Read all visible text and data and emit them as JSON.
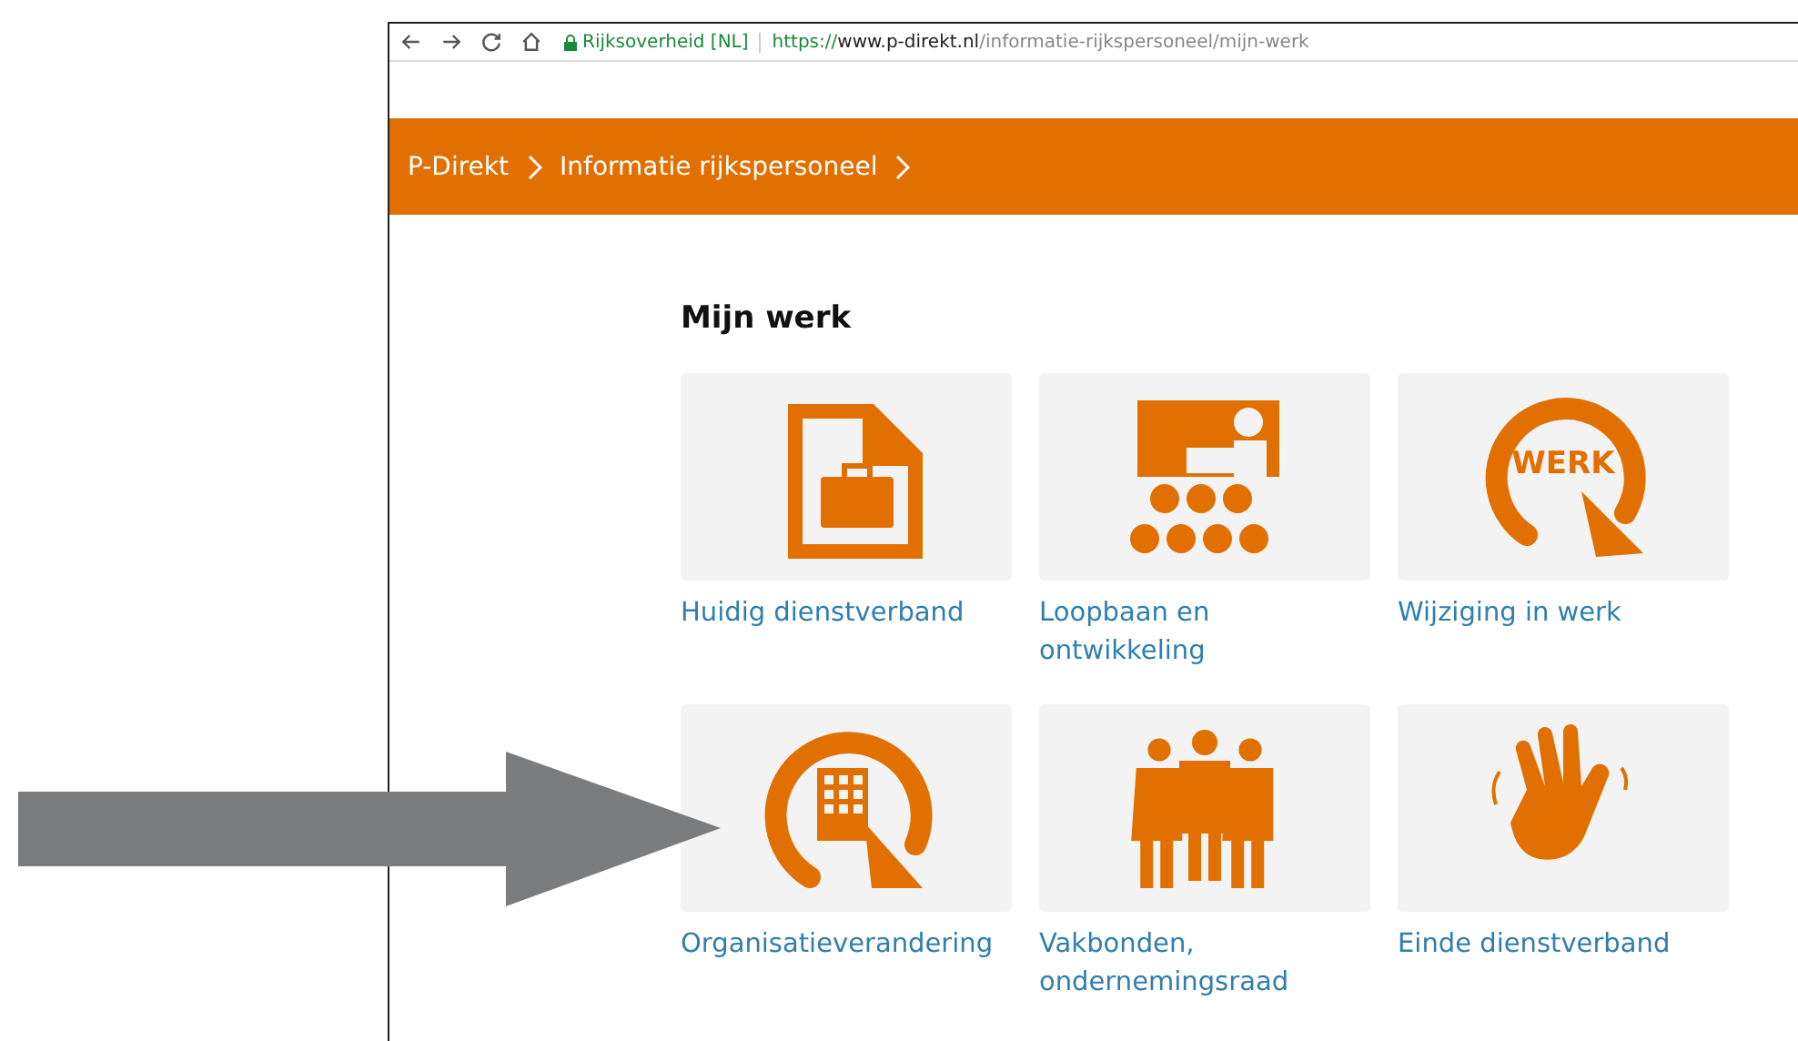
{
  "browser": {
    "nav_buttons": [
      {
        "kind": "back"
      },
      {
        "kind": "forward"
      },
      {
        "kind": "reload"
      },
      {
        "kind": "home"
      }
    ],
    "site_badge": "Rijksoverheid [NL]",
    "url": {
      "scheme": "https://",
      "host": "www.p-direkt.nl",
      "path": "/informatie-rijkspersoneel/mijn-werk"
    }
  },
  "breadcrumb": [
    "P-Direkt",
    "Informatie rijkspersoneel"
  ],
  "title": "Mijn werk",
  "tiles": [
    {
      "kind": "document",
      "label": "Huidig dienstverband"
    },
    {
      "kind": "presentation",
      "label": "Loopbaan en ontwikkeling"
    },
    {
      "kind": "werk",
      "label": "Wijziging in werk",
      "icon_text": "WERK"
    },
    {
      "kind": "organisation",
      "label": "Organisatieverandering"
    },
    {
      "kind": "people",
      "label": "Vakbonden, ondernemingsraad"
    },
    {
      "kind": "hand",
      "label": "Einde dienstverband"
    }
  ],
  "annotation": {
    "kind": "arrow"
  }
}
